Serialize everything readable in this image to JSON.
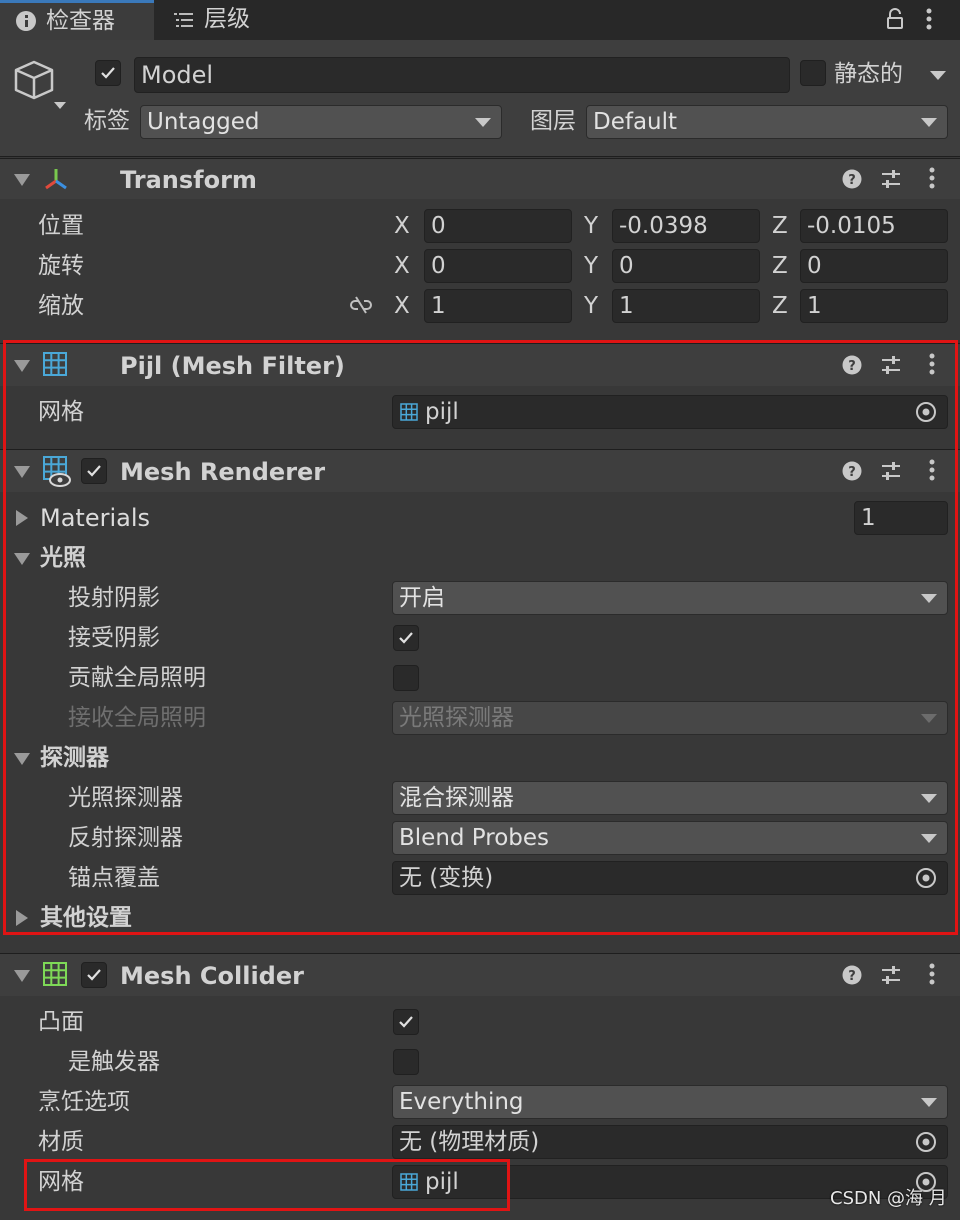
{
  "tabs": [
    {
      "label": "检查器",
      "icon": "info-icon",
      "active": true
    },
    {
      "label": "层级",
      "icon": "list-icon",
      "active": false
    }
  ],
  "object": {
    "active": true,
    "name": "Model",
    "static_label": "静态的",
    "tag_label": "标签",
    "tag_value": "Untagged",
    "layer_label": "图层",
    "layer_value": "Default"
  },
  "transform": {
    "title": "Transform",
    "rows": [
      {
        "label": "位置",
        "x": "0",
        "y": "-0.0398",
        "z": "-0.0105"
      },
      {
        "label": "旋转",
        "x": "0",
        "y": "0",
        "z": "0"
      },
      {
        "label": "缩放",
        "x": "1",
        "y": "1",
        "z": "1"
      }
    ],
    "axis_x": "X",
    "axis_y": "Y",
    "axis_z": "Z"
  },
  "mesh_filter": {
    "title": "Pijl (Mesh Filter)",
    "mesh_label": "网格",
    "mesh_value": "pijl"
  },
  "mesh_renderer": {
    "enabled": true,
    "title": "Mesh Renderer",
    "materials_label": "Materials",
    "materials_count": "1",
    "lighting_label": "光照",
    "cast_shadows_label": "投射阴影",
    "cast_shadows_value": "开启",
    "receive_shadows_label": "接受阴影",
    "receive_shadows": true,
    "contribute_gi_label": "贡献全局照明",
    "contribute_gi": false,
    "receive_gi_label": "接收全局照明",
    "receive_gi_value": "光照探测器",
    "probes_label": "探测器",
    "light_probes_label": "光照探测器",
    "light_probes_value": "混合探测器",
    "reflection_probes_label": "反射探测器",
    "reflection_probes_value": "Blend Probes",
    "anchor_override_label": "锚点覆盖",
    "anchor_override_value": "无 (变换)",
    "additional_settings_label": "其他设置"
  },
  "mesh_collider": {
    "enabled": true,
    "title": "Mesh Collider",
    "convex_label": "凸面",
    "convex": true,
    "is_trigger_label": "是触发器",
    "is_trigger": false,
    "cooking_label": "烹饪选项",
    "cooking_value": "Everything",
    "material_label": "材质",
    "material_value": "无 (物理材质)",
    "mesh_label": "网格",
    "mesh_value": "pijl"
  },
  "watermark": "CSDN @海 月",
  "colors": {
    "highlight_box": "#e01414",
    "mesh_icon_blue": "#4aa8d8",
    "collider_icon_green": "#7ed957"
  }
}
